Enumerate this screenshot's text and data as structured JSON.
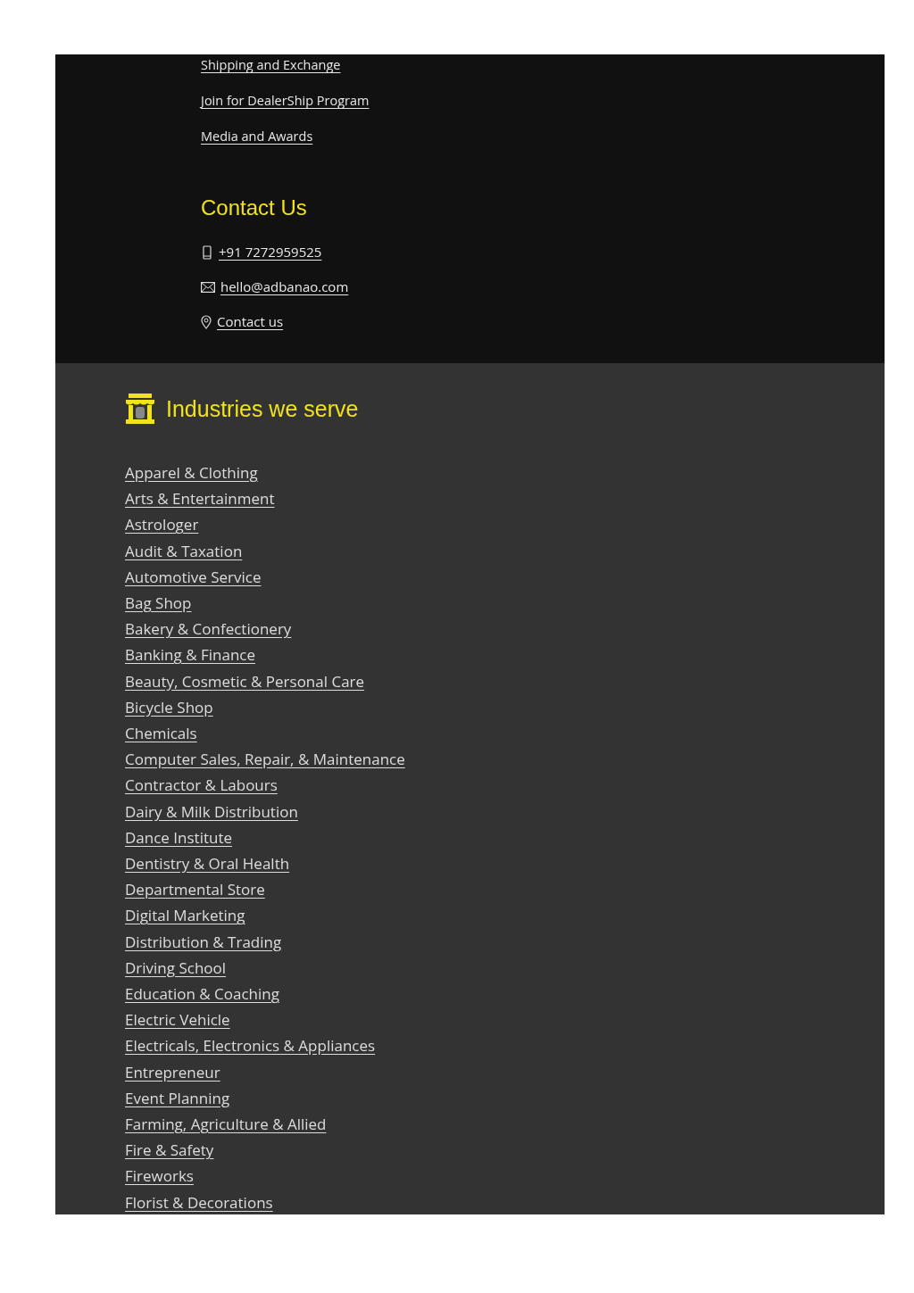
{
  "footer_links": [
    "Shipping and Exchange",
    "Join for DealerShip Program",
    "Media and Awards"
  ],
  "contact": {
    "heading": "Contact Us",
    "items": [
      {
        "kind": "phone",
        "label": "+91 7272959525"
      },
      {
        "kind": "email",
        "label": "hello@adbanao.com"
      },
      {
        "kind": "location",
        "label": "Contact us"
      }
    ]
  },
  "industries": {
    "heading": "Industries we serve",
    "items": [
      "Apparel & Clothing",
      "Arts & Entertainment",
      "Astrologer",
      "Audit & Taxation",
      "Automotive Service",
      "Bag Shop",
      "Bakery & Confectionery",
      "Banking & Finance",
      "Beauty, Cosmetic & Personal Care",
      "Bicycle Shop",
      "Chemicals",
      "Computer Sales, Repair, & Maintenance",
      "Contractor & Labours",
      "Dairy & Milk Distribution",
      "Dance Institute",
      "Dentistry & Oral Health",
      "Departmental Store",
      "Digital Marketing",
      "Distribution & Trading",
      "Driving School",
      "Education & Coaching",
      "Electric Vehicle",
      "Electricals, Electronics & Appliances",
      "Entrepreneur",
      "Event Planning",
      "Farming, Agriculture & Allied",
      "Fire & Safety",
      "Fireworks",
      "Florist & Decorations"
    ]
  }
}
